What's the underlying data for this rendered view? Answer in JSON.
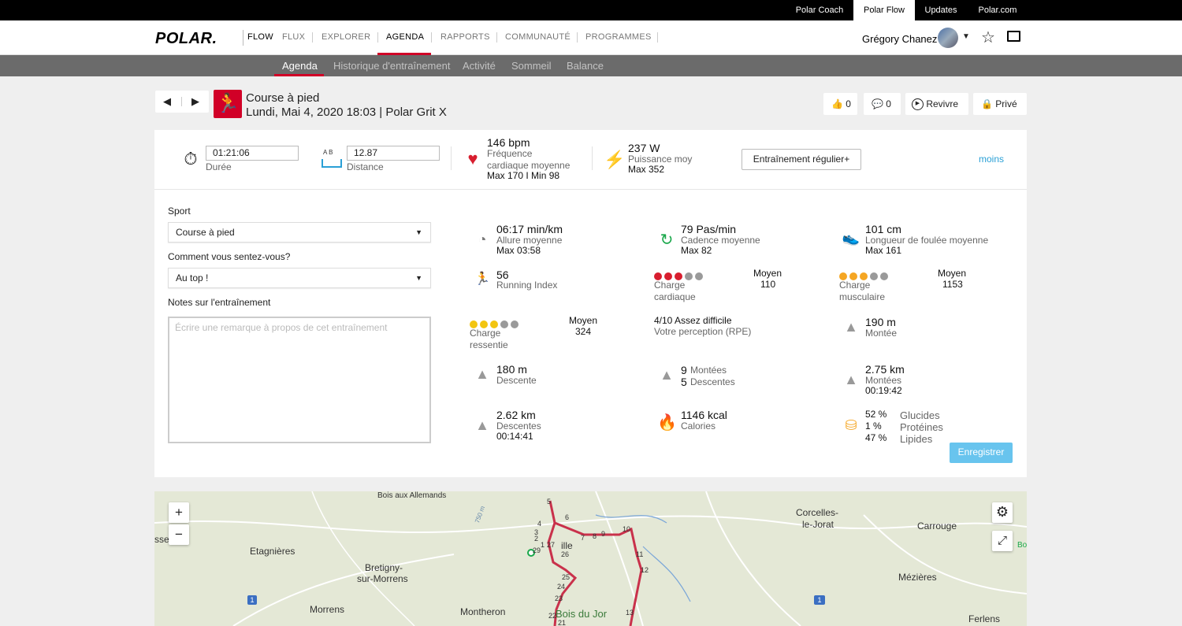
{
  "topbar": {
    "items": [
      "Polar Coach",
      "Polar Flow",
      "Updates",
      "Polar.com"
    ]
  },
  "navbar": {
    "logo": "POLAR.",
    "flow": "FLOW",
    "items": [
      "FLUX",
      "EXPLORER",
      "AGENDA",
      "RAPPORTS",
      "COMMUNAUTÉ",
      "PROGRAMMES"
    ],
    "active": "AGENDA",
    "user": "Grégory Chanez"
  },
  "subnav": {
    "items": [
      "Agenda",
      "Historique d'entraînement",
      "Activité",
      "Sommeil",
      "Balance"
    ],
    "active": "Agenda"
  },
  "session": {
    "title": "Course à pied",
    "subtitle": "Lundi, Mai 4, 2020 18:03 | Polar Grit X",
    "likes": "0",
    "comments": "0",
    "revivre": "Revivre",
    "prive": "Privé"
  },
  "summary": {
    "duration_value": "01:21:06",
    "duration_label": "Durée",
    "ab_label": "A  B",
    "distance_value": "12.87",
    "distance_label": "Distance",
    "hr_value": "146 bpm",
    "hr_label1": "Fréquence",
    "hr_label2": "cardiaque moyenne",
    "hr_minmax": "Max 170  I  Min 98",
    "power_value": "237 W",
    "power_label": "Puissance moy",
    "power_max": "Max 352",
    "type_button": "Entraînement régulier+",
    "less_link": "moins"
  },
  "form": {
    "sport_label": "Sport",
    "sport_value": "Course à pied",
    "feeling_label": "Comment vous sentez-vous?",
    "feeling_value": "Au top !",
    "notes_label": "Notes sur l'entraînement",
    "notes_placeholder": "Écrire une remarque à propos de cet entraînement",
    "save_button": "Enregistrer"
  },
  "metrics": {
    "pace_value": "06:17 min/km",
    "pace_label": "Allure moyenne",
    "pace_max": "Max 03:58",
    "cadence_value": "79 Pas/min",
    "cadence_label": "Cadence moyenne",
    "cadence_max": "Max 82",
    "stride_value": "101 cm",
    "stride_label": "Longueur de foulée moyenne",
    "stride_max": "Max 161",
    "ri_value": "56",
    "ri_label": "Running Index",
    "cardio_level": "Moyen",
    "cardio_value": "110",
    "cardio_label1": "Charge",
    "cardio_label2": "cardiaque",
    "cardio_filled": 3,
    "muscle_level": "Moyen",
    "muscle_value": "1153",
    "muscle_label1": "Charge",
    "muscle_label2": "musculaire",
    "muscle_filled": 3,
    "perceived_level": "Moyen",
    "perceived_value": "324",
    "perceived_label1": "Charge",
    "perceived_label2": "ressentie",
    "perceived_filled": 3,
    "rpe_value": "4/10 Assez difficile",
    "rpe_label": "Votre perception (RPE)",
    "ascent_value": "190 m",
    "ascent_label": "Montée",
    "descent_value": "180 m",
    "descent_label": "Descente",
    "climbs_count": "9",
    "climbs_label": "Montées",
    "descents_count": "5",
    "descents_label": "Descentes",
    "climb_dist_value": "2.75 km",
    "climb_dist_label": "Montées",
    "climb_dist_time": "00:19:42",
    "desc_dist_value": "2.62 km",
    "desc_dist_label": "Descentes",
    "desc_dist_time": "00:14:41",
    "calories_value": "1146 kcal",
    "calories_label": "Calories",
    "carbs_pct": "52 %",
    "carbs_label": "Glucides",
    "protein_pct": "1 %",
    "protein_label": "Protéines",
    "fat_pct": "47 %",
    "fat_label": "Lipides"
  },
  "colors": {
    "accent": "#d10027",
    "link": "#2aa0d6",
    "cardio_dot": "#d81e2f",
    "muscle_dot": "#f5a623",
    "perceived_dot": "#f2c511",
    "empty_dot": "#9a9a9a"
  },
  "map": {
    "labels": [
      "Bois aux Allemands",
      "Etagnières",
      "Bretigny-",
      "sur-Morrens",
      "Morrens",
      "Montheron",
      "Bois du Jor",
      "Corcelles-",
      "le-Jorat",
      "Carrouge",
      "Mézières",
      "Ferlens",
      "sse",
      "Bo",
      "750 m",
      "ille"
    ],
    "route_markers": [
      "5",
      "4",
      "6",
      "8",
      "9",
      "10",
      "7",
      "2",
      "3",
      "1",
      "27",
      "29",
      "26",
      "11",
      "12",
      "25",
      "24",
      "23",
      "22",
      "21",
      "13"
    ],
    "road_badges": [
      "1",
      "1"
    ],
    "zoom_in": "+",
    "zoom_out": "−"
  }
}
